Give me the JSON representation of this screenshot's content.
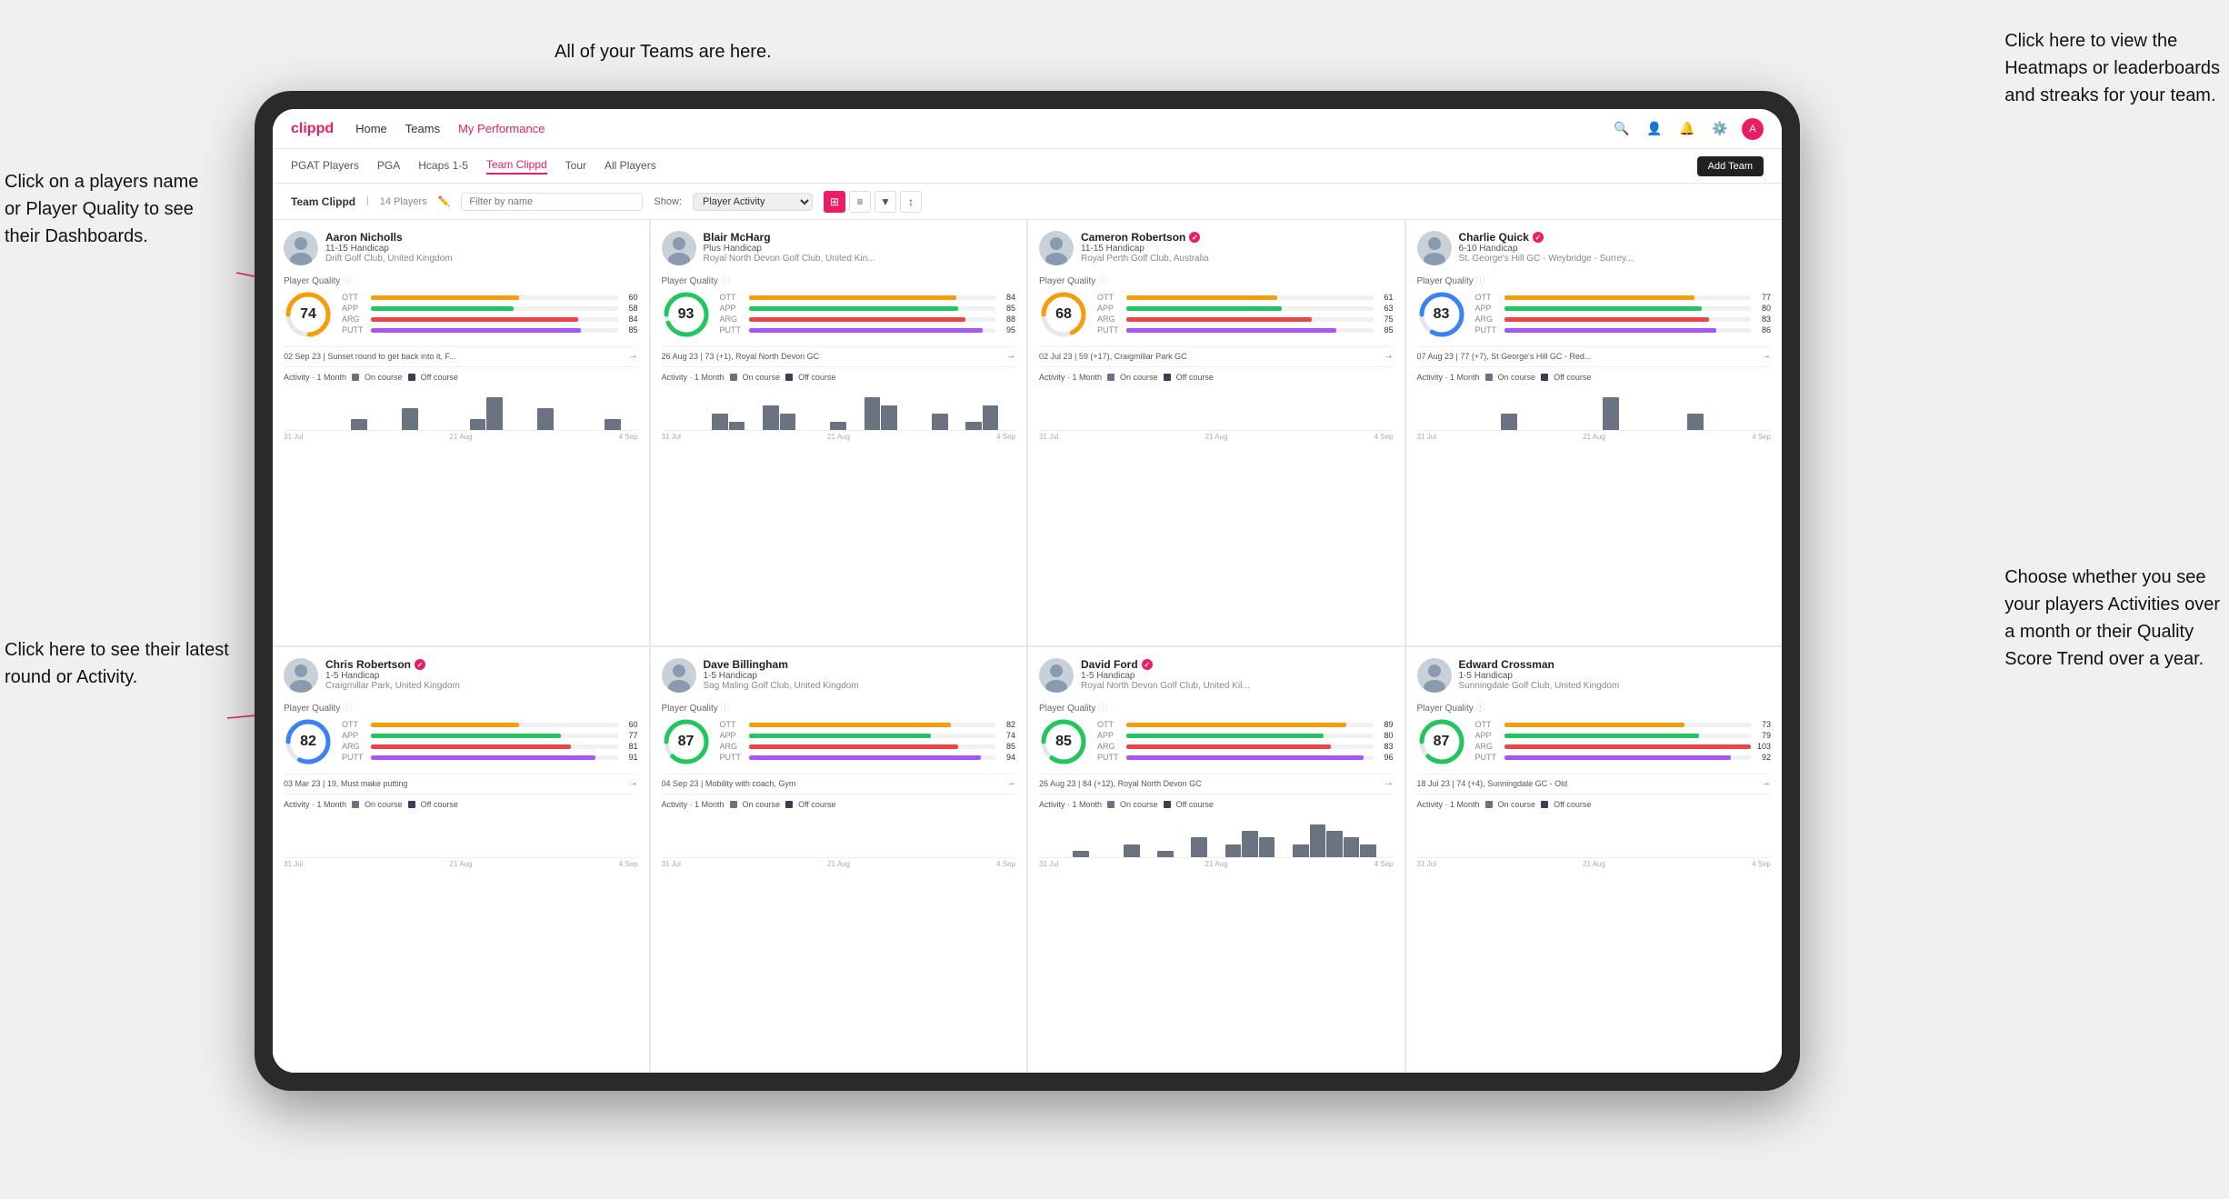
{
  "annotations": {
    "teams_tooltip": "All of your Teams are here.",
    "heatmaps_tooltip": "Click here to view the\nHeatmaps or leaderboards\nand streaks for your team.",
    "player_name_tooltip": "Click on a players name\nor Player Quality to see\ntheir Dashboards.",
    "round_tooltip": "Click here to see their latest\nround or Activity.",
    "activity_tooltip": "Choose whether you see\nyour players Activities over\na month or their Quality\nScore Trend over a year."
  },
  "nav": {
    "logo": "clippd",
    "items": [
      "Home",
      "Teams",
      "My Performance"
    ],
    "add_team": "Add Team"
  },
  "sub_nav": {
    "items": [
      "PGAT Players",
      "PGA",
      "Hcaps 1-5",
      "Team Clippd",
      "Tour",
      "All Players"
    ]
  },
  "team_header": {
    "title": "Team Clippd",
    "count": "14 Players",
    "show_label": "Show:",
    "show_value": "Player Activity",
    "filter_placeholder": "Filter by name"
  },
  "players": [
    {
      "name": "Aaron Nicholls",
      "handicap": "11-15 Handicap",
      "club": "Drift Golf Club, United Kingdom",
      "quality": 74,
      "verified": false,
      "ott": 60,
      "app": 58,
      "arg": 84,
      "putt": 85,
      "recent": "02 Sep 23 | Sunset round to get back into it, F...",
      "bars": [
        0,
        0,
        0,
        0,
        1,
        0,
        0,
        2,
        0,
        0,
        0,
        1,
        3,
        0,
        0,
        2,
        0,
        0,
        0,
        1,
        0
      ]
    },
    {
      "name": "Blair McHarg",
      "handicap": "Plus Handicap",
      "club": "Royal North Devon Golf Club, United Kin...",
      "quality": 93,
      "verified": false,
      "ott": 84,
      "app": 85,
      "arg": 88,
      "putt": 95,
      "recent": "26 Aug 23 | 73 (+1), Royal North Devon GC",
      "bars": [
        0,
        0,
        0,
        2,
        1,
        0,
        3,
        2,
        0,
        0,
        1,
        0,
        4,
        3,
        0,
        0,
        2,
        0,
        1,
        3,
        0
      ]
    },
    {
      "name": "Cameron Robertson",
      "handicap": "11-15 Handicap",
      "club": "Royal Perth Golf Club, Australia",
      "quality": 68,
      "verified": true,
      "ott": 61,
      "app": 63,
      "arg": 75,
      "putt": 85,
      "recent": "02 Jul 23 | 59 (+17), Craigmillar Park GC",
      "bars": [
        0,
        0,
        0,
        0,
        0,
        0,
        0,
        0,
        0,
        0,
        0,
        0,
        0,
        0,
        0,
        0,
        0,
        0,
        0,
        0,
        0
      ]
    },
    {
      "name": "Charlie Quick",
      "handicap": "6-10 Handicap",
      "club": "St. George's Hill GC - Weybridge - Surrey...",
      "quality": 83,
      "verified": true,
      "ott": 77,
      "app": 80,
      "arg": 83,
      "putt": 86,
      "recent": "07 Aug 23 | 77 (+7), St George's Hill GC - Red...",
      "bars": [
        0,
        0,
        0,
        0,
        0,
        1,
        0,
        0,
        0,
        0,
        0,
        2,
        0,
        0,
        0,
        0,
        1,
        0,
        0,
        0,
        0
      ]
    },
    {
      "name": "Chris Robertson",
      "handicap": "1-5 Handicap",
      "club": "Craigmillar Park, United Kingdom",
      "quality": 82,
      "verified": true,
      "ott": 60,
      "app": 77,
      "arg": 81,
      "putt": 91,
      "recent": "03 Mar 23 | 19, Must make putting",
      "bars": [
        0,
        0,
        0,
        0,
        0,
        0,
        0,
        0,
        0,
        0,
        0,
        0,
        0,
        0,
        0,
        0,
        0,
        0,
        0,
        0,
        0
      ]
    },
    {
      "name": "Dave Billingham",
      "handicap": "1-5 Handicap",
      "club": "Sag Maling Golf Club, United Kingdom",
      "quality": 87,
      "verified": false,
      "ott": 82,
      "app": 74,
      "arg": 85,
      "putt": 94,
      "recent": "04 Sep 23 | Mobility with coach, Gym",
      "bars": [
        0,
        0,
        0,
        0,
        0,
        0,
        0,
        0,
        0,
        0,
        0,
        0,
        0,
        0,
        0,
        0,
        0,
        0,
        0,
        0,
        0
      ]
    },
    {
      "name": "David Ford",
      "handicap": "1-5 Handicap",
      "club": "Royal North Devon Golf Club, United Kil...",
      "quality": 85,
      "verified": true,
      "ott": 89,
      "app": 80,
      "arg": 83,
      "putt": 96,
      "recent": "26 Aug 23 | 84 (+12), Royal North Devon GC",
      "bars": [
        0,
        0,
        1,
        0,
        0,
        2,
        0,
        1,
        0,
        3,
        0,
        2,
        4,
        3,
        0,
        2,
        5,
        4,
        3,
        2,
        0
      ]
    },
    {
      "name": "Edward Crossman",
      "handicap": "1-5 Handicap",
      "club": "Sunningdale Golf Club, United Kingdom",
      "quality": 87,
      "verified": false,
      "ott": 73,
      "app": 79,
      "arg": 103,
      "putt": 92,
      "recent": "18 Jul 23 | 74 (+4), Sunningdale GC - Old",
      "bars": [
        0,
        0,
        0,
        0,
        0,
        0,
        0,
        0,
        0,
        0,
        0,
        0,
        0,
        0,
        0,
        0,
        0,
        0,
        0,
        0,
        0
      ]
    }
  ],
  "colors": {
    "ott": "#f59e0b",
    "app": "#22c55e",
    "arg": "#ef4444",
    "putt": "#a855f7",
    "on_course": "#6b7280",
    "off_course": "#374151",
    "brand": "#e91e63"
  },
  "chart_labels": [
    "31 Jul",
    "21 Aug",
    "4 Sep"
  ]
}
